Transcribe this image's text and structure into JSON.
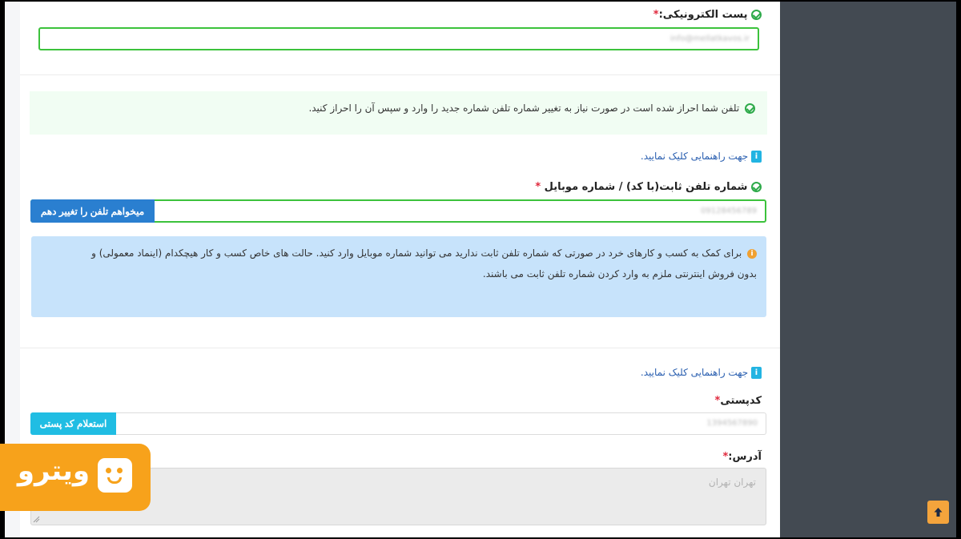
{
  "email": {
    "label": "پست الکترونیکی:",
    "required_mark": "*",
    "value": "info@mellatkavos.ir"
  },
  "phone_verified_notice": "تلفن شما احراز شده است در صورت نیاز به تغییر شماره تلفن شماره جدید را وارد و سپس آن را احراز کنید.",
  "help_link_1": "جهت راهنمایی کلیک نمایید.",
  "phone": {
    "label": "شماره تلفن ثابت(با کد) / شماره موبایل",
    "required_mark": "*",
    "value": "09128456789",
    "change_button": "میخواهم تلفن را تغییر دهم"
  },
  "info_box": {
    "line1": "برای کمک به کسب و کارهای خرد در صورتی که شماره تلفن ثابت ندارید می توانید شماره موبایل وارد کنید. حالت های خاص کسب و کار هیچکدام (اینماد معمولی) و",
    "line2": "بدون فروش اینترنتی ملزم به وارد کردن شماره تلفن ثابت می باشند."
  },
  "help_link_2": "جهت راهنمایی کلیک نمایید.",
  "postal": {
    "label": "کدپستی",
    "required_mark": "*",
    "value": "1394567890",
    "inquiry_button": "استعلام کد پستی"
  },
  "address": {
    "label": "آدرس:",
    "required_mark": "*",
    "placeholder": "تهران تهران"
  },
  "watermark": {
    "text": "ویترو"
  },
  "colors": {
    "success_green": "#3cc23c",
    "info_bg": "#c7e3fb",
    "success_bg": "#f1fdf3",
    "watermark_orange": "#f7a21b",
    "sidebar": "#434a52"
  }
}
